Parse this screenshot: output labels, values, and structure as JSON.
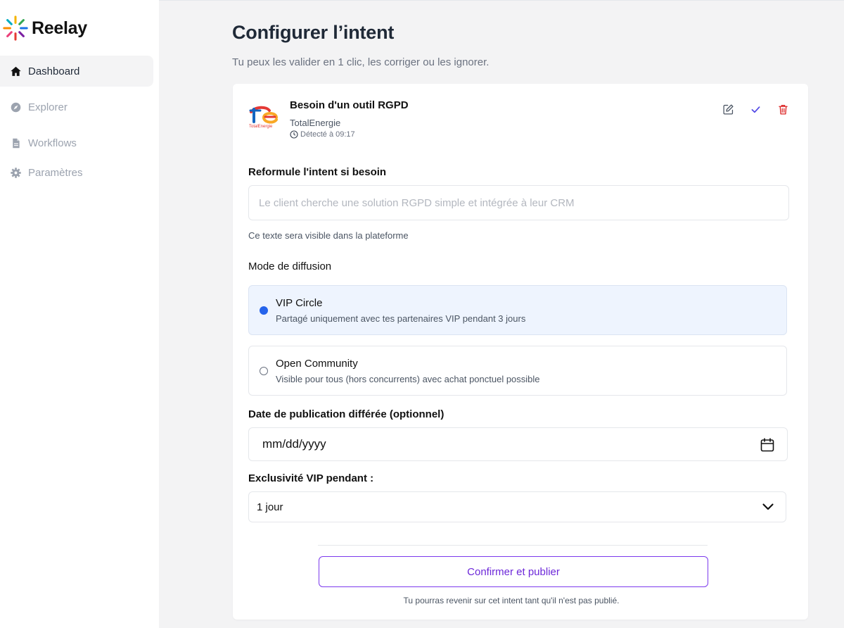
{
  "app": {
    "logo_text": "Reelay",
    "logo_icon": "sunburst-icon"
  },
  "sidebar": {
    "items": [
      {
        "label": "Dashboard",
        "icon": "home-icon",
        "active": true
      },
      {
        "label": "Explorer",
        "icon": "compass-icon",
        "active": false
      },
      {
        "label": "Workflows",
        "icon": "file-icon",
        "active": false
      },
      {
        "label": "Paramètres",
        "icon": "gear-icon",
        "active": false
      }
    ]
  },
  "header": {
    "title": "Configurer l’intent",
    "subtitle": "Tu peux les valider en 1 clic, les corriger ou les ignorer."
  },
  "intent": {
    "title": "Besoin d'un outil RGPD",
    "company": "TotalEnergie",
    "detected": "Détecté à 09:17",
    "brand_logo_text": "TotalEnergie",
    "actions": [
      "edit-icon",
      "check-icon",
      "trash-icon"
    ]
  },
  "form": {
    "reformulate_label": "Reformule l'intent si besoin",
    "reformulate_value": "",
    "reformulate_placeholder": "Le client cherche une solution RGPD simple et intégrée à leur CRM",
    "reformulate_helper": "Ce texte sera visible dans la plateforme",
    "mode_label": "Mode de diffusion",
    "modes": [
      {
        "title": "VIP Circle",
        "description": "Partagé uniquement avec tes partenaires VIP pendant 3 jours",
        "selected": true
      },
      {
        "title": "Open Community",
        "description": "Visible pour tous (hors concurrents) avec achat ponctuel possible",
        "selected": false
      }
    ],
    "date_label": "Date de publication différée (optionnel)",
    "date_value": "mm/dd/yyyy",
    "exclusivity_label": "Exclusivité VIP pendant :",
    "exclusivity_value": "1 jour",
    "confirm_label": "Confirmer et publier",
    "footnote": "Tu pourras revenir sur cet intent tant qu'il n'est pas publié."
  },
  "colors": {
    "accent": "#7c3aed",
    "radio_on": "#2563eb",
    "selected_bg": "#eef4fe",
    "check": "#4f46e5",
    "danger": "#dc2626"
  }
}
